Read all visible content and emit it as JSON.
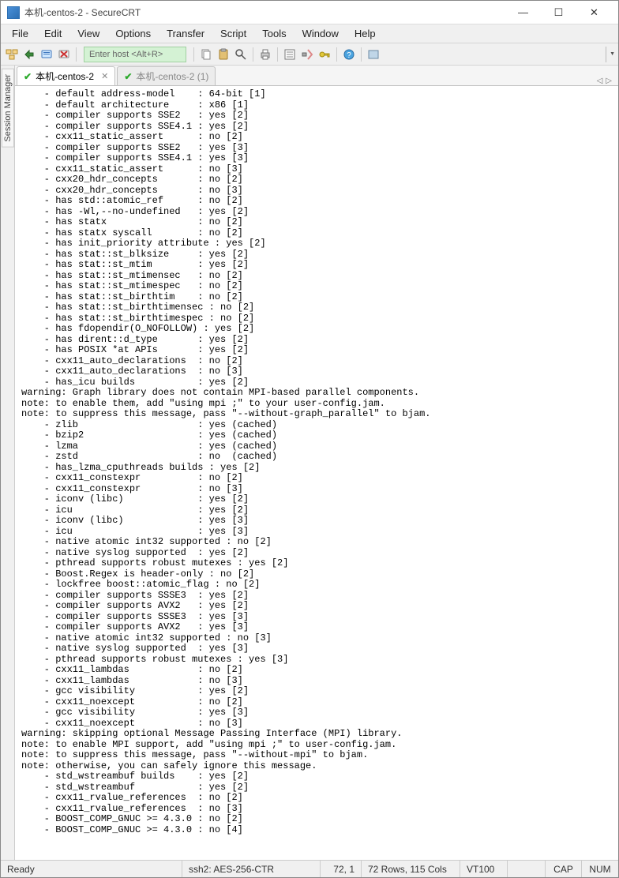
{
  "window": {
    "title": "本机-centos-2 - SecureCRT",
    "minimize": "—",
    "maximize": "☐",
    "close": "✕"
  },
  "menu": {
    "file": "File",
    "edit": "Edit",
    "view": "View",
    "options": "Options",
    "transfer": "Transfer",
    "script": "Script",
    "tools": "Tools",
    "window": "Window",
    "help": "Help"
  },
  "toolbar": {
    "host_placeholder": "Enter host <Alt+R>"
  },
  "sidebar": {
    "session_manager": "Session Manager"
  },
  "tabs": [
    {
      "label": "本机-centos-2",
      "active": true,
      "closable": true
    },
    {
      "label": "本机-centos-2 (1)",
      "active": false,
      "closable": false
    }
  ],
  "nav": {
    "left": "◁",
    "right": "▷"
  },
  "terminal_lines": [
    "    - default address-model    : 64-bit [1]",
    "    - default architecture     : x86 [1]",
    "    - compiler supports SSE2   : yes [2]",
    "    - compiler supports SSE4.1 : yes [2]",
    "    - cxx11_static_assert      : no [2]",
    "    - compiler supports SSE2   : yes [3]",
    "    - compiler supports SSE4.1 : yes [3]",
    "    - cxx11_static_assert      : no [3]",
    "    - cxx20_hdr_concepts       : no [2]",
    "    - cxx20_hdr_concepts       : no [3]",
    "    - has std::atomic_ref      : no [2]",
    "    - has -Wl,--no-undefined   : yes [2]",
    "    - has statx                : no [2]",
    "    - has statx syscall        : no [2]",
    "    - has init_priority attribute : yes [2]",
    "    - has stat::st_blksize     : yes [2]",
    "    - has stat::st_mtim        : yes [2]",
    "    - has stat::st_mtimensec   : no [2]",
    "    - has stat::st_mtimespec   : no [2]",
    "    - has stat::st_birthtim    : no [2]",
    "    - has stat::st_birthtimensec : no [2]",
    "    - has stat::st_birthtimespec : no [2]",
    "    - has fdopendir(O_NOFOLLOW) : yes [2]",
    "    - has dirent::d_type       : yes [2]",
    "    - has POSIX *at APIs       : yes [2]",
    "    - cxx11_auto_declarations  : no [2]",
    "    - cxx11_auto_declarations  : no [3]",
    "    - has_icu builds           : yes [2]",
    "warning: Graph library does not contain MPI-based parallel components.",
    "note: to enable them, add \"using mpi ;\" to your user-config.jam.",
    "note: to suppress this message, pass \"--without-graph_parallel\" to bjam.",
    "    - zlib                     : yes (cached)",
    "    - bzip2                    : yes (cached)",
    "    - lzma                     : yes (cached)",
    "    - zstd                     : no  (cached)",
    "    - has_lzma_cputhreads builds : yes [2]",
    "    - cxx11_constexpr          : no [2]",
    "    - cxx11_constexpr          : no [3]",
    "    - iconv (libc)             : yes [2]",
    "    - icu                      : yes [2]",
    "    - iconv (libc)             : yes [3]",
    "    - icu                      : yes [3]",
    "    - native atomic int32 supported : no [2]",
    "    - native syslog supported  : yes [2]",
    "    - pthread supports robust mutexes : yes [2]",
    "    - Boost.Regex is header-only : no [2]",
    "    - lockfree boost::atomic_flag : no [2]",
    "    - compiler supports SSSE3  : yes [2]",
    "    - compiler supports AVX2   : yes [2]",
    "    - compiler supports SSSE3  : yes [3]",
    "    - compiler supports AVX2   : yes [3]",
    "    - native atomic int32 supported : no [3]",
    "    - native syslog supported  : yes [3]",
    "    - pthread supports robust mutexes : yes [3]",
    "    - cxx11_lambdas            : no [2]",
    "    - cxx11_lambdas            : no [3]",
    "    - gcc visibility           : yes [2]",
    "    - cxx11_noexcept           : no [2]",
    "    - gcc visibility           : yes [3]",
    "    - cxx11_noexcept           : no [3]",
    "warning: skipping optional Message Passing Interface (MPI) library.",
    "note: to enable MPI support, add \"using mpi ;\" to user-config.jam.",
    "note: to suppress this message, pass \"--without-mpi\" to bjam.",
    "note: otherwise, you can safely ignore this message.",
    "    - std_wstreambuf builds    : yes [2]",
    "    - std_wstreambuf           : yes [2]",
    "    - cxx11_rvalue_references  : no [2]",
    "    - cxx11_rvalue_references  : no [3]",
    "    - BOOST_COMP_GNUC >= 4.3.0 : no [2]",
    "    - BOOST_COMP_GNUC >= 4.3.0 : no [4]"
  ],
  "status": {
    "ready": "Ready",
    "cipher": "ssh2: AES-256-CTR",
    "pos": "72,  1",
    "size": "72 Rows, 115 Cols",
    "vt": "VT100",
    "cap": "CAP",
    "num": "NUM"
  }
}
